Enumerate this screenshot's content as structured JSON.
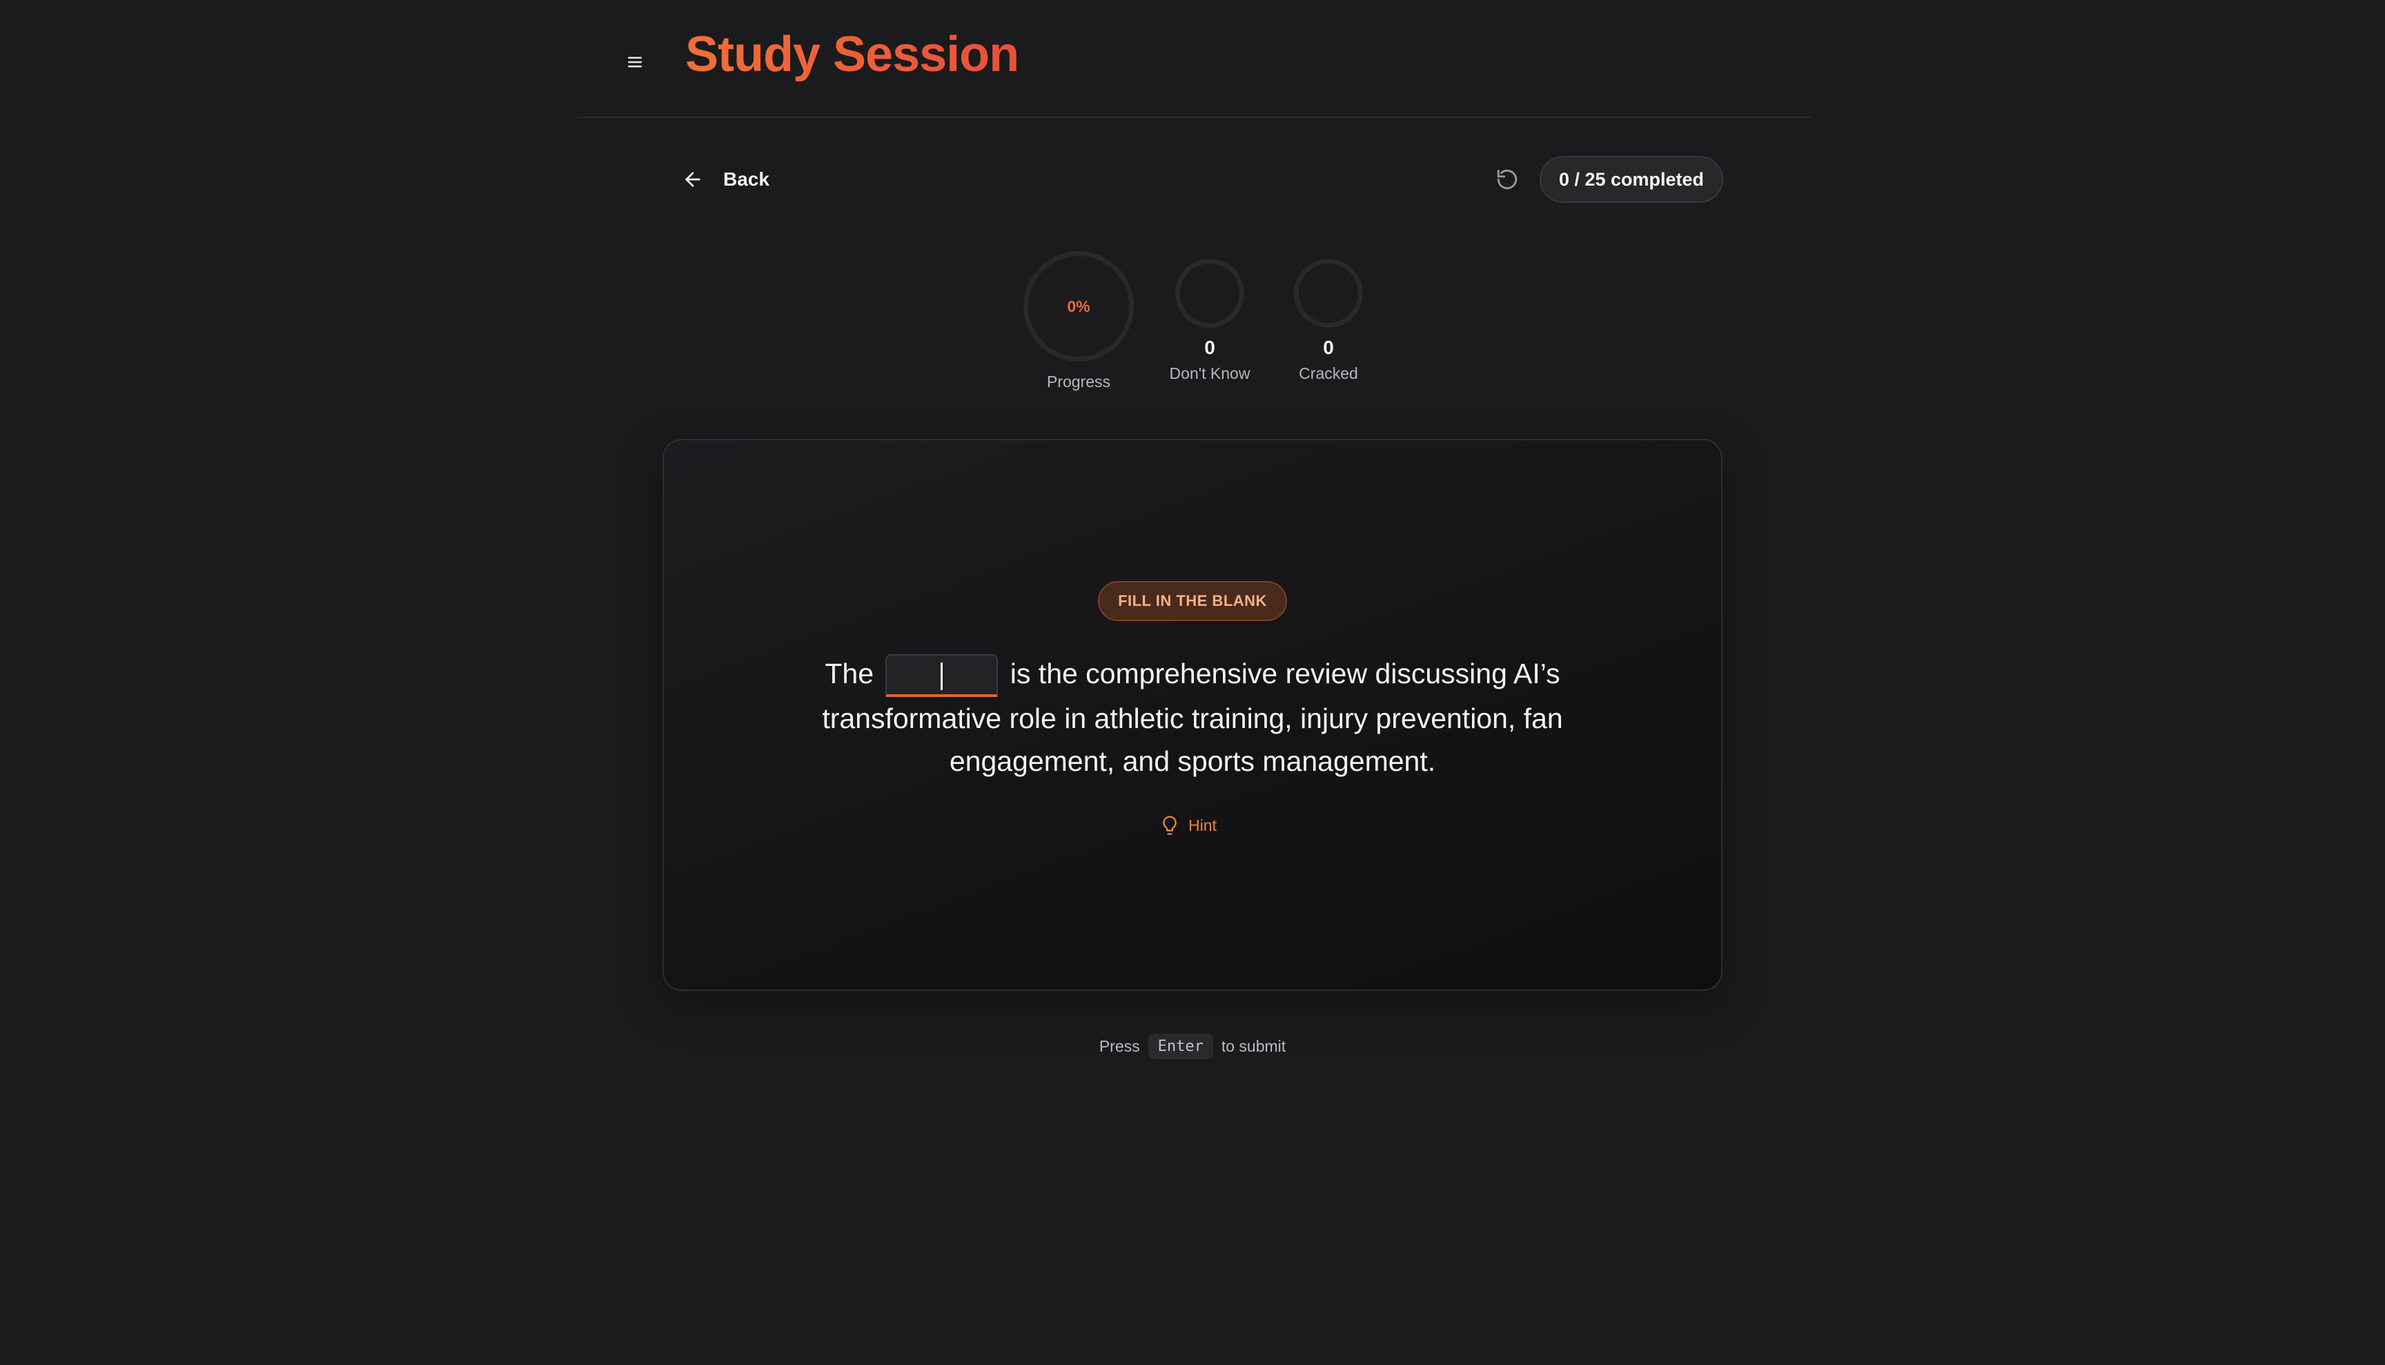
{
  "header": {
    "title": "Study Session",
    "menu_icon": "hamburger-menu-icon"
  },
  "toolbar": {
    "back_label": "Back",
    "back_icon": "arrow-left-icon",
    "reset_icon": "rotate-ccw-icon",
    "completed_text": "0 / 25 completed"
  },
  "stats": {
    "progress": {
      "value": "0%",
      "label": "Progress",
      "fraction": 0
    },
    "dont_know": {
      "count": "0",
      "label": "Don't Know"
    },
    "cracked": {
      "count": "0",
      "label": "Cracked"
    }
  },
  "card": {
    "type_label": "FILL IN THE BLANK",
    "question_before": "The",
    "question_after": "is the comprehensive review discussing AI’s transformative role in athletic training, injury prevention, fan engagement, and sports management.",
    "answer_value": "",
    "hint_label": "Hint",
    "hint_icon": "lightbulb-icon"
  },
  "footer": {
    "press_label": "Press",
    "key_label": "Enter",
    "submit_label": "to submit"
  },
  "colors": {
    "accent": "#e8693d",
    "background": "#1b1b1d",
    "card_border": "#2e2e31"
  }
}
